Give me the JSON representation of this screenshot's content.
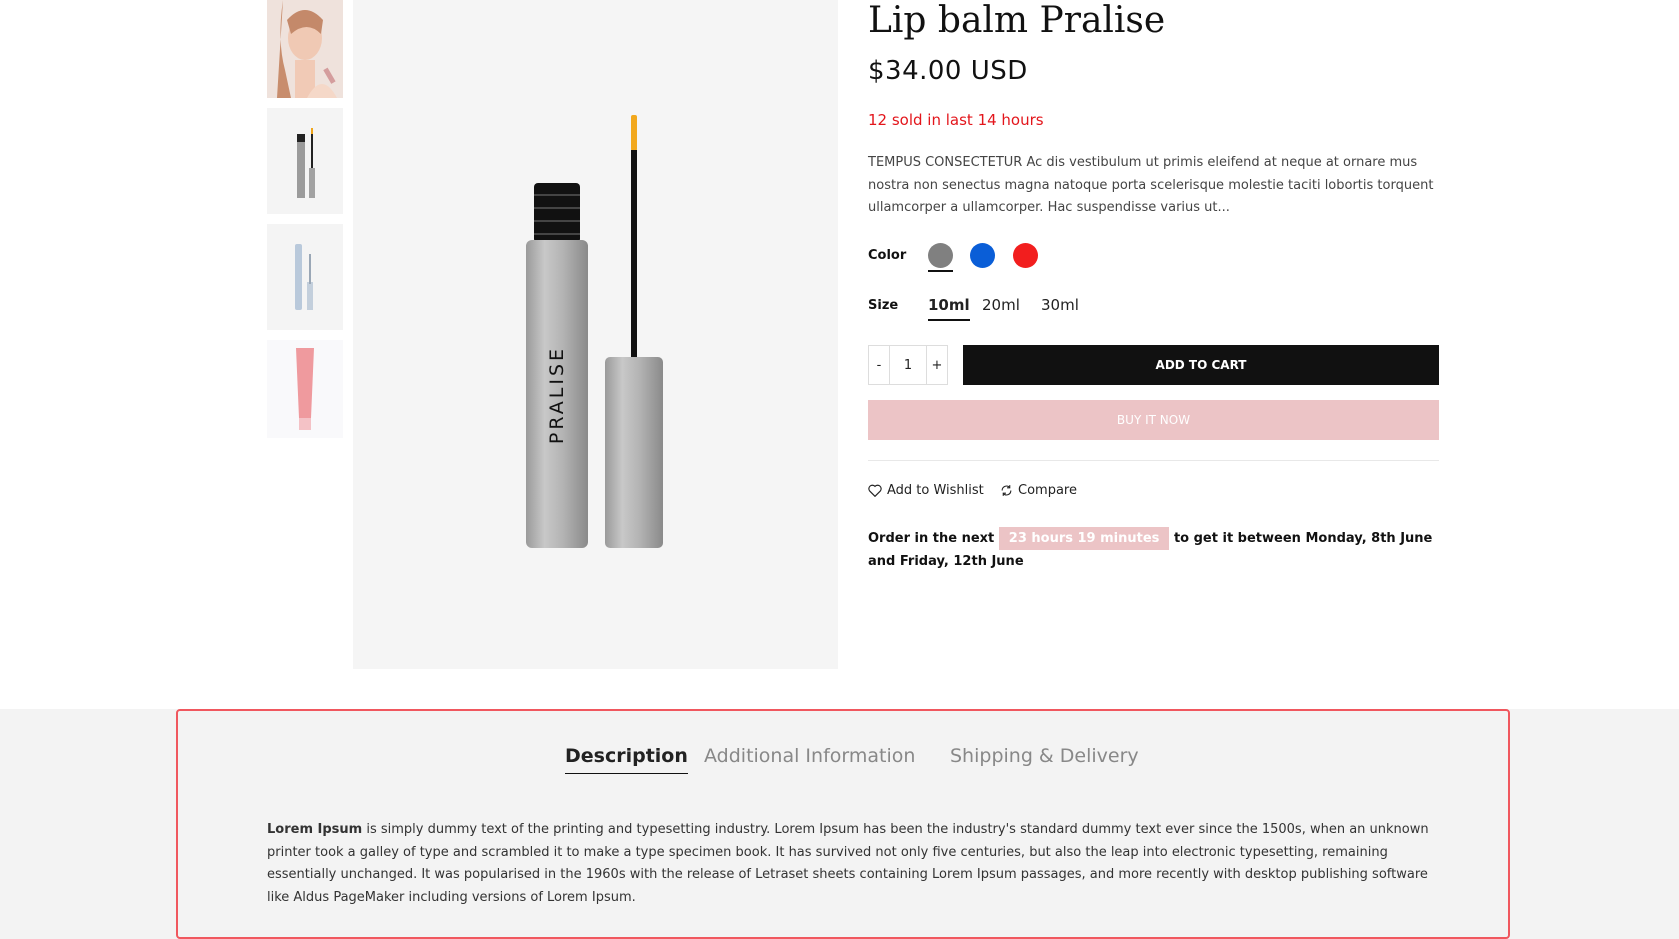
{
  "product": {
    "title": "Lip balm Pralise",
    "price": "$34.00 USD",
    "sold_notice": "12 sold in last 14 hours",
    "description": "TEMPUS CONSECTETUR Ac dis vestibulum ut primis eleifend at neque at ornare mus nostra non senectus magna natoque porta scelerisque molestie taciti lobortis torquent ullamcorper a ullamcorper. Hac suspendisse varius ut...",
    "brand_text": "PRALISE"
  },
  "options": {
    "color_label": "Color",
    "colors": [
      "#808080",
      "#0a5ed7",
      "#f21e1e"
    ],
    "selected_color_index": 0,
    "size_label": "Size",
    "sizes": [
      "10ml",
      "20ml",
      "30ml"
    ],
    "selected_size": "10ml"
  },
  "cart": {
    "minus": "-",
    "quantity": "1",
    "plus": "+",
    "add_to_cart": "ADD TO CART",
    "buy_now": "BUY IT NOW"
  },
  "actions": {
    "wishlist": "Add to Wishlist",
    "compare": "Compare"
  },
  "order": {
    "prefix": "Order in the next",
    "timer": "23 hours 19 minutes",
    "suffix": "to get it between Monday, 8th June and Friday, 12th June"
  },
  "tabs": {
    "items": [
      "Description",
      "Additional Information",
      "Shipping & Delivery"
    ],
    "active": "Description"
  },
  "tab_content": {
    "lead": "Lorem Ipsum",
    "body": " is simply dummy text of the printing and typesetting industry. Lorem Ipsum has been the industry's standard dummy text ever since the 1500s, when an unknown printer took a galley of type and scrambled it to make a type specimen book. It has survived not only five centuries, but also the leap into electronic typesetting, remaining essentially unchanged. It was popularised in the 1960s with the release of Letraset sheets containing Lorem Ipsum passages, and more recently with desktop publishing software like Aldus PageMaker including versions of Lorem Ipsum."
  },
  "icons": {
    "wishlist": "heart-icon",
    "compare": "refresh-icon"
  }
}
